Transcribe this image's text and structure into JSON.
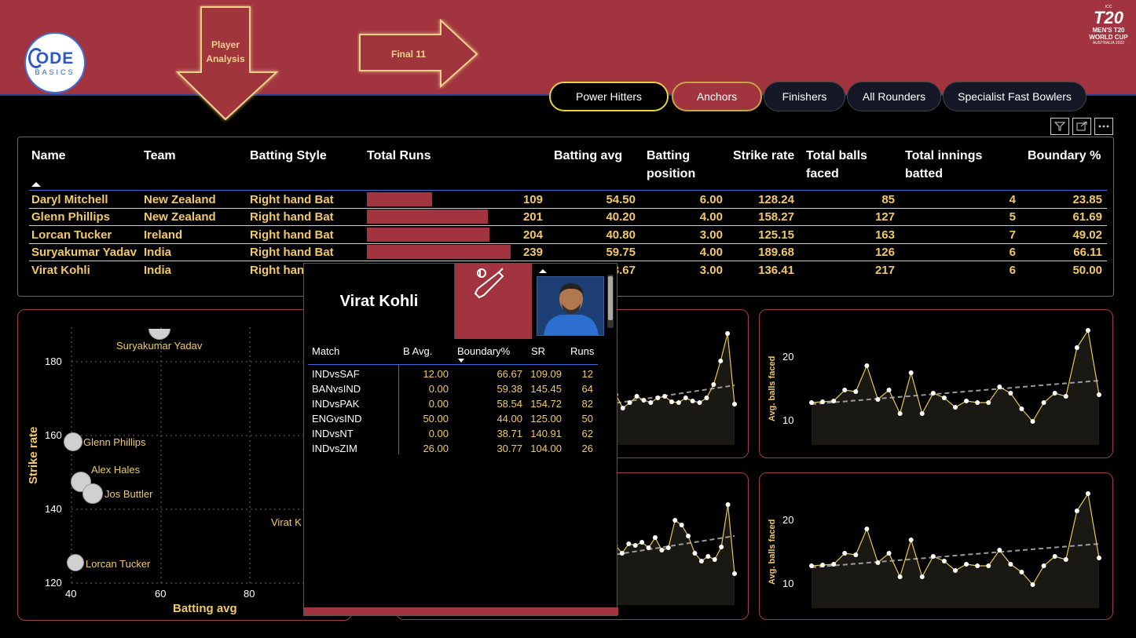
{
  "header": {
    "logo_text": "ODE",
    "logo_sub": "BASICS",
    "nav_player": "Player Analysis",
    "nav_final": "Final 11",
    "wc_logo_top": "T20",
    "wc_logo_l1": "MEN'S T20",
    "wc_logo_l2": "WORLD CUP",
    "wc_logo_l3": "AUSTRALIA 2022",
    "wc_logo_icc": "ICC"
  },
  "tabs": [
    "Power Hitters",
    "Anchors",
    "Finishers",
    "All Rounders",
    "Specialist Fast Bowlers"
  ],
  "colors": {
    "accent": "#a1343e",
    "gold": "#f1c96a",
    "highlight": "#e6d23a"
  },
  "table": {
    "headers": {
      "name": "Name",
      "team": "Team",
      "style": "Batting Style",
      "runs": "Total Runs",
      "avg": "Batting avg",
      "pos1": "Batting",
      "pos2": "position",
      "sr": "Strike rate",
      "balls1": "Total balls",
      "balls2": "faced",
      "inn1": "Total innings",
      "inn2": "batted",
      "boundary": "Boundary %"
    },
    "rows": [
      {
        "name": "Daryl Mitchell",
        "team": "New Zealand",
        "style": "Right hand Bat",
        "runs": "109",
        "runs_fill": 0.456,
        "avg": "54.50",
        "pos": "6.00",
        "sr": "128.24",
        "balls": "85",
        "inn": "4",
        "boundary": "23.85"
      },
      {
        "name": "Glenn Phillips",
        "team": "New Zealand",
        "style": "Right hand Bat",
        "runs": "201",
        "runs_fill": 0.841,
        "avg": "40.20",
        "pos": "4.00",
        "sr": "158.27",
        "balls": "127",
        "inn": "5",
        "boundary": "61.69"
      },
      {
        "name": "Lorcan Tucker",
        "team": "Ireland",
        "style": "Right hand Bat",
        "runs": "204",
        "runs_fill": 0.854,
        "avg": "40.80",
        "pos": "3.00",
        "sr": "125.15",
        "balls": "163",
        "inn": "7",
        "boundary": "49.02"
      },
      {
        "name": "Suryakumar Yadav",
        "team": "India",
        "style": "Right hand Bat",
        "runs": "239",
        "runs_fill": 1.0,
        "avg": "59.75",
        "pos": "4.00",
        "sr": "189.68",
        "balls": "126",
        "inn": "6",
        "boundary": "66.11"
      },
      {
        "name": "Virat Kohli",
        "team": "India",
        "style": "Right hand Bat",
        "runs": "",
        "runs_fill": 0.0,
        "avg": "3.67",
        "pos": "3.00",
        "sr": "136.41",
        "balls": "217",
        "inn": "6",
        "boundary": "50.00"
      }
    ]
  },
  "scatter": {
    "xlabel": "Batting avg",
    "ylabel": "Strike rate",
    "xticks": [
      "40",
      "60",
      "80"
    ],
    "yticks": [
      "180",
      "160",
      "140",
      "120"
    ],
    "labels": [
      "Suryakumar Yadav",
      "Glenn Phillips",
      "Alex Hales",
      "Jos Buttler",
      "Lorcan Tucker",
      "Virat K"
    ]
  },
  "line_charts": {
    "ylabel": "Avg. balls faced",
    "tick_20": "20",
    "tick_10": "10"
  },
  "tooltip": {
    "player": "Virat Kohli",
    "headers": [
      "Match",
      "B Avg.",
      "Boundary%",
      "SR",
      "Runs"
    ],
    "rows": [
      {
        "match": "INDvsSAF",
        "bavg": "12.00",
        "boundary": "66.67",
        "sr": "109.09",
        "runs": "12"
      },
      {
        "match": "BANvsIND",
        "bavg": "0.00",
        "boundary": "59.38",
        "sr": "145.45",
        "runs": "64"
      },
      {
        "match": "INDvsPAK",
        "bavg": "0.00",
        "boundary": "58.54",
        "sr": "154.72",
        "runs": "82"
      },
      {
        "match": "ENGvsIND",
        "bavg": "50.00",
        "boundary": "44.00",
        "sr": "125.00",
        "runs": "50"
      },
      {
        "match": "INDvsNT",
        "bavg": "0.00",
        "boundary": "38.71",
        "sr": "140.91",
        "runs": "62"
      },
      {
        "match": "INDvsZIM",
        "bavg": "26.00",
        "boundary": "30.77",
        "sr": "104.00",
        "runs": "26"
      }
    ]
  },
  "icons": {
    "filter": "filter-icon",
    "focus": "focus-mode-icon",
    "more": "more-options-icon",
    "bat": "cricket-bat-icon"
  }
}
